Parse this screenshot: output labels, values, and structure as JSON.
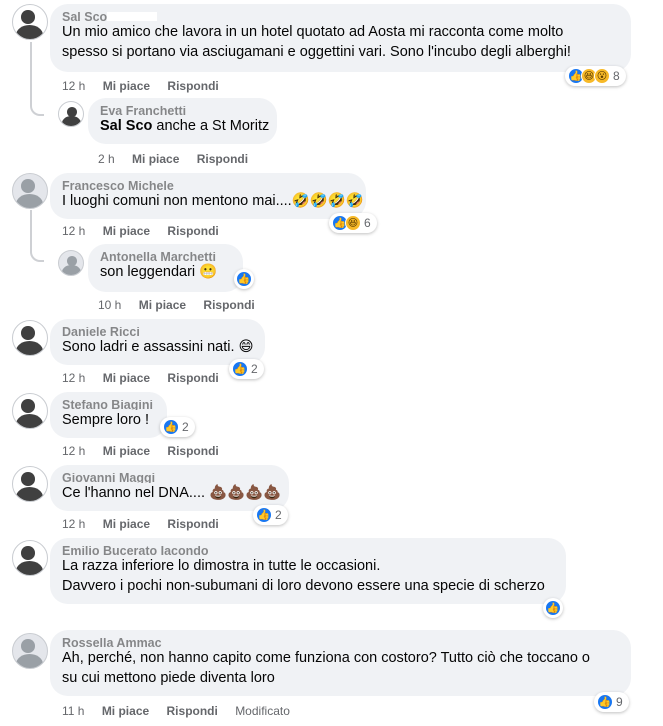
{
  "comments": [
    {
      "author": "Sal Sco",
      "text_lines": [
        "Un mio amico che lavora in un hotel quotato ad Aosta mi racconta come molto",
        "spesso si portano via asciugamani e oggettini vari. Sono l'incubo degli alberghi!"
      ],
      "time": "12 h",
      "like_label": "Mi piace",
      "reply_label": "Rispondi",
      "reactions": [
        "like",
        "haha",
        "wow"
      ],
      "reaction_count": "8"
    },
    {
      "author": "Eva Franchetti",
      "mention": "Sal Sco",
      "text_lines": [
        " anche a St Moritz"
      ],
      "time": "2 h",
      "like_label": "Mi piace",
      "reply_label": "Rispondi"
    },
    {
      "author": "Francesco Michele",
      "text_lines": [
        "I luoghi comuni non mentono mai....🤣🤣🤣🤣"
      ],
      "time": "12 h",
      "like_label": "Mi piace",
      "reply_label": "Rispondi",
      "reactions": [
        "like",
        "haha"
      ],
      "reaction_count": "6"
    },
    {
      "author": "Antonella Marchetti",
      "text_lines": [
        "son leggendari 😬"
      ],
      "time": "10 h",
      "like_label": "Mi piace",
      "reply_label": "Rispondi",
      "reactions": [
        "like"
      ],
      "reaction_count": ""
    },
    {
      "author": "Daniele Ricci",
      "text_lines": [
        "Sono ladri e assassini nati. 😄"
      ],
      "time": "12 h",
      "like_label": "Mi piace",
      "reply_label": "Rispondi",
      "reactions": [
        "like"
      ],
      "reaction_count": "2"
    },
    {
      "author": "Stefano Biagini",
      "text_lines": [
        "Sempre loro !"
      ],
      "time": "12 h",
      "like_label": "Mi piace",
      "reply_label": "Rispondi",
      "reactions": [
        "like"
      ],
      "reaction_count": "2"
    },
    {
      "author": "Giovanni Maggi",
      "text_lines": [
        "Ce l'hanno nel DNA.... 💩💩💩💩"
      ],
      "time": "12 h",
      "like_label": "Mi piace",
      "reply_label": "Rispondi",
      "reactions": [
        "like"
      ],
      "reaction_count": "2"
    },
    {
      "author": "Emilio Bucerato Iacondo",
      "text_lines": [
        "La razza inferiore lo dimostra in tutte le occasioni.",
        "Davvero i pochi non-subumani di loro devono essere una specie di scherzo"
      ],
      "time": "12 h",
      "like_label": "Mi piace",
      "reply_label": "Rispondi",
      "reactions": [
        "like"
      ],
      "reaction_count": ""
    },
    {
      "author": "Rossella Ammac",
      "text_lines": [
        "Ah, perché, non hanno capito come funziona con costoro? Tutto ciò che toccano o",
        "su cui mettono piede diventa loro"
      ],
      "time": "11 h",
      "like_label": "Mi piace",
      "reply_label": "Rispondi",
      "edited_label": "Modificato",
      "reactions": [
        "like"
      ],
      "reaction_count": "9"
    }
  ],
  "icons": {
    "like": "thumbs-up-icon",
    "haha": "laughing-face-icon",
    "wow": "surprised-face-icon"
  },
  "colors": {
    "bubble": "#f0f2f5",
    "meta": "#65676b",
    "like_blue": "#1877f2",
    "reaction_yellow": "#f7b928"
  }
}
